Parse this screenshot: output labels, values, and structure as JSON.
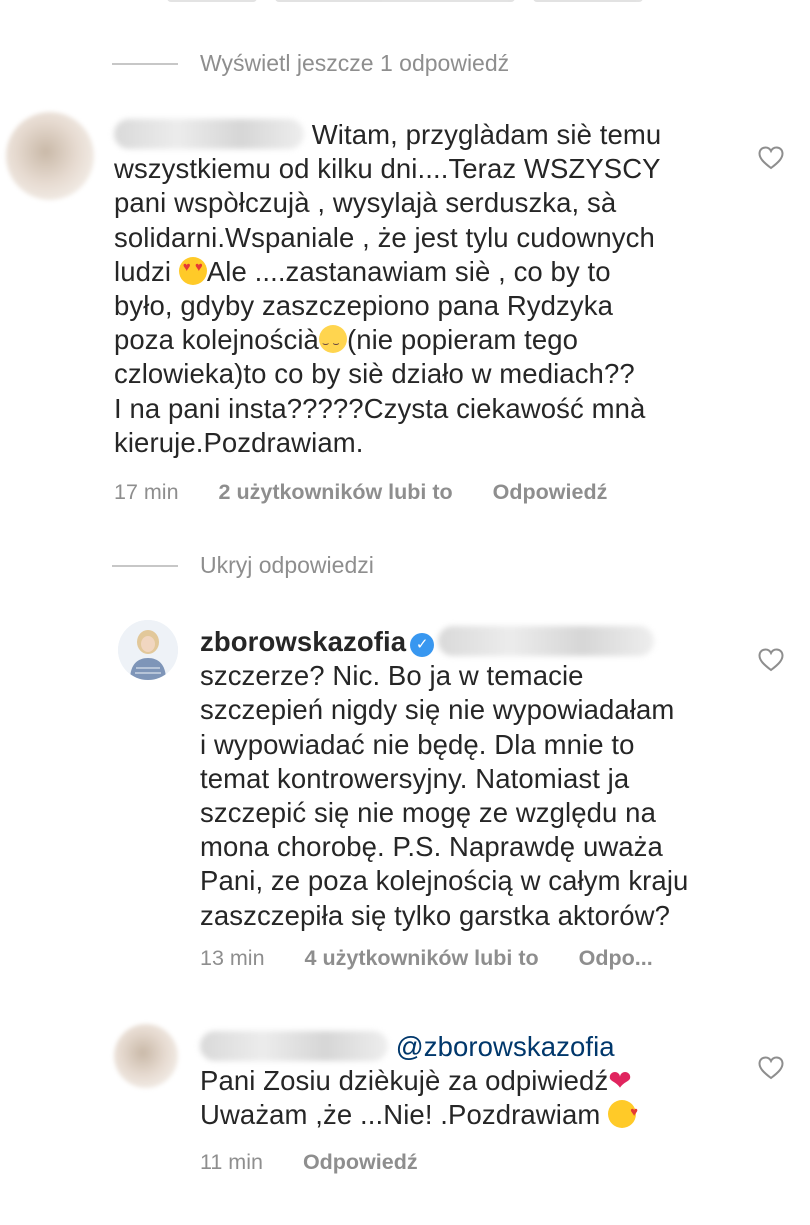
{
  "thread1": {
    "replies_toggle": "Wyświetl jeszcze 1 odpowiedź"
  },
  "comment1": {
    "line1": "Witam, przyglàdam siè  temu",
    "line2": "wszystkiemu od kilku dni....Teraz WSZYSCY",
    "line3": "pani wspòłczujà , wysylajà serduszka, sà",
    "line4": "solidarni.Wspaniale , że jest tylu cudownych",
    "line5_a": "ludzi ",
    "line5_b": "Ale ....zastanawiam siè , co by to",
    "line6": "było, gdyby zaszczepiono pana Rydzyka",
    "line7_a": "poza kolejnościà",
    "line7_b": "(nie popieram tego",
    "line8": "czlowieka)to co by siè działo w mediach??",
    "line9": "I na pani insta?????Czysta ciekawość mnà",
    "line10": "kieruje.Pozdrawiam.",
    "time": "17 min",
    "likes": "2 użytkowników lubi to",
    "reply": "Odpowiedź"
  },
  "thread2": {
    "replies_toggle": "Ukryj odpowiedzi"
  },
  "reply1": {
    "username": "zborowskazofia",
    "line1": "szczerze? Nic. Bo ja w temacie",
    "line2": "szczepień nigdy się nie wypowiadałam",
    "line3": "i wypowiadać nie będę. Dla mnie to",
    "line4": "temat kontrowersyjny. Natomiast ja",
    "line5": "szczepić się nie mogę ze względu na",
    "line6": "mona chorobę. P.S. Naprawdę uważa",
    "line7": "Pani, ze poza kolejnością w całym kraju",
    "line8": "zaszczepiła się tylko garstka aktorów?",
    "time": "13 min",
    "likes": "4 użytkowników lubi to",
    "reply": "Odpo..."
  },
  "reply2": {
    "mention": "@zborowskazofia",
    "line1": "Pani Zosiu dzièkujè za odpiwiedź",
    "line2": "Uważam ,że ...Nie! .Pozdrawiam ",
    "time": "11 min",
    "reply": "Odpowiedź"
  },
  "icons": {
    "like": "heart-outline-icon",
    "verified": "verified-badge-icon"
  },
  "colors": {
    "text": "#262626",
    "secondary": "#8e8e8e",
    "verified": "#3897f0",
    "mention": "#00376b"
  }
}
